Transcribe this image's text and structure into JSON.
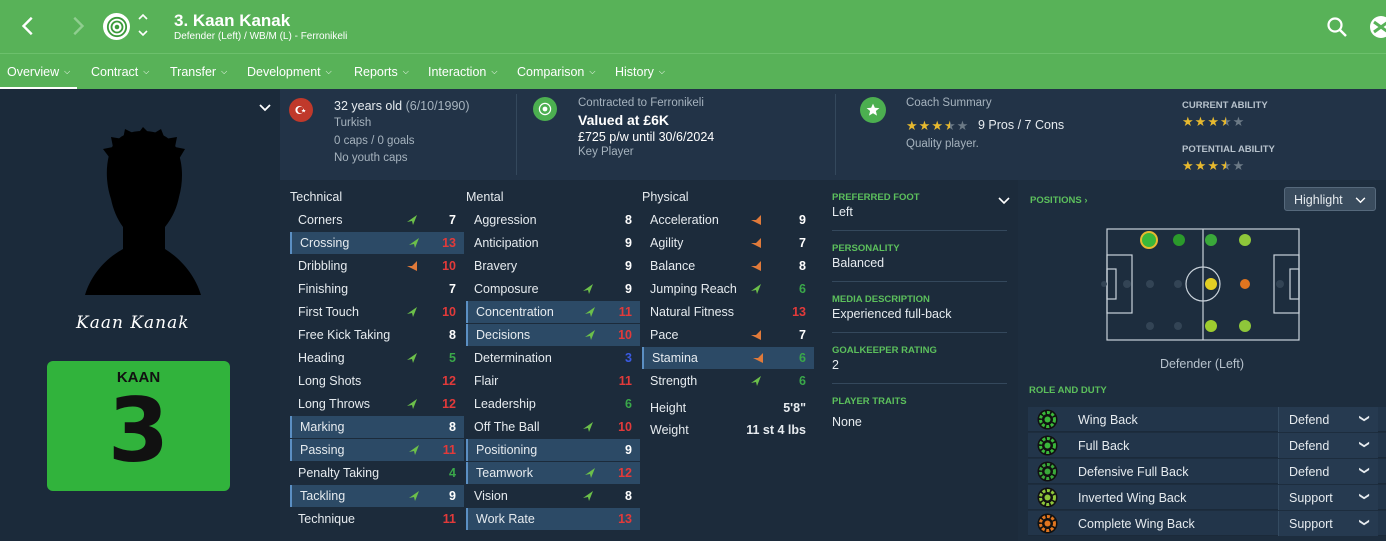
{
  "header": {
    "title": "3. Kaan Kanak",
    "subtitle": "Defender (Left) / WB/M (L) - Ferronikeli"
  },
  "tabs": [
    {
      "label": "Overview"
    },
    {
      "label": "Contract"
    },
    {
      "label": "Transfer"
    },
    {
      "label": "Development"
    },
    {
      "label": "Reports"
    },
    {
      "label": "Interaction"
    },
    {
      "label": "Comparison"
    },
    {
      "label": "History"
    }
  ],
  "player": {
    "signature": "Kaan Kanak",
    "shirt_name": "KAAN",
    "shirt_number": "3",
    "age": "32 years old",
    "dob": "(6/10/1990)",
    "nationality": "Turkish",
    "caps": "0 caps / 0 goals",
    "youth_caps": "No youth caps"
  },
  "contract": {
    "label": "Contracted to Ferronikeli",
    "value": "Valued at £6K",
    "wage": "£725 p/w until 30/6/2024",
    "status": "Key Player"
  },
  "coach": {
    "label": "Coach Summary",
    "stars": 3.5,
    "pros_cons": "9 Pros / 7 Cons",
    "summary": "Quality player."
  },
  "ability": {
    "current_label": "CURRENT ABILITY",
    "current_stars": 3.5,
    "potential_label": "POTENTIAL ABILITY",
    "potential_stars": 3.5
  },
  "attributes": {
    "technical_label": "Technical",
    "mental_label": "Mental",
    "physical_label": "Physical",
    "technical": [
      {
        "name": "Corners",
        "value": "7",
        "arrow": "up",
        "hl": false,
        "color": "#ffffff"
      },
      {
        "name": "Crossing",
        "value": "13",
        "arrow": "up",
        "hl": true,
        "color": "#e23a3a"
      },
      {
        "name": "Dribbling",
        "value": "10",
        "arrow": "down",
        "hl": false,
        "color": "#e23a3a"
      },
      {
        "name": "Finishing",
        "value": "7",
        "arrow": "",
        "hl": false,
        "color": "#ffffff"
      },
      {
        "name": "First Touch",
        "value": "10",
        "arrow": "up",
        "hl": false,
        "color": "#e23a3a"
      },
      {
        "name": "Free Kick Taking",
        "value": "8",
        "arrow": "",
        "hl": false,
        "color": "#ffffff"
      },
      {
        "name": "Heading",
        "value": "5",
        "arrow": "up",
        "hl": false,
        "color": "#3aa84a"
      },
      {
        "name": "Long Shots",
        "value": "12",
        "arrow": "",
        "hl": false,
        "color": "#e23a3a"
      },
      {
        "name": "Long Throws",
        "value": "12",
        "arrow": "up",
        "hl": false,
        "color": "#e23a3a"
      },
      {
        "name": "Marking",
        "value": "8",
        "arrow": "",
        "hl": true,
        "color": "#ffffff"
      },
      {
        "name": "Passing",
        "value": "11",
        "arrow": "up",
        "hl": true,
        "color": "#e23a3a"
      },
      {
        "name": "Penalty Taking",
        "value": "4",
        "arrow": "",
        "hl": false,
        "color": "#3aa84a"
      },
      {
        "name": "Tackling",
        "value": "9",
        "arrow": "up",
        "hl": true,
        "color": "#ffffff"
      },
      {
        "name": "Technique",
        "value": "11",
        "arrow": "",
        "hl": false,
        "color": "#e23a3a"
      }
    ],
    "mental": [
      {
        "name": "Aggression",
        "value": "8",
        "arrow": "",
        "hl": false,
        "color": "#ffffff"
      },
      {
        "name": "Anticipation",
        "value": "9",
        "arrow": "",
        "hl": false,
        "color": "#ffffff"
      },
      {
        "name": "Bravery",
        "value": "9",
        "arrow": "",
        "hl": false,
        "color": "#ffffff"
      },
      {
        "name": "Composure",
        "value": "9",
        "arrow": "up",
        "hl": false,
        "color": "#ffffff"
      },
      {
        "name": "Concentration",
        "value": "11",
        "arrow": "up",
        "hl": true,
        "color": "#e23a3a"
      },
      {
        "name": "Decisions",
        "value": "10",
        "arrow": "up",
        "hl": true,
        "color": "#e23a3a"
      },
      {
        "name": "Determination",
        "value": "3",
        "arrow": "",
        "hl": false,
        "color": "#3a5ae2"
      },
      {
        "name": "Flair",
        "value": "11",
        "arrow": "",
        "hl": false,
        "color": "#e23a3a"
      },
      {
        "name": "Leadership",
        "value": "6",
        "arrow": "",
        "hl": false,
        "color": "#3aa84a"
      },
      {
        "name": "Off The Ball",
        "value": "10",
        "arrow": "up",
        "hl": false,
        "color": "#e23a3a"
      },
      {
        "name": "Positioning",
        "value": "9",
        "arrow": "",
        "hl": true,
        "color": "#ffffff"
      },
      {
        "name": "Teamwork",
        "value": "12",
        "arrow": "up",
        "hl": true,
        "color": "#e23a3a"
      },
      {
        "name": "Vision",
        "value": "8",
        "arrow": "up",
        "hl": false,
        "color": "#ffffff"
      },
      {
        "name": "Work Rate",
        "value": "13",
        "arrow": "",
        "hl": true,
        "color": "#e23a3a"
      }
    ],
    "physical": [
      {
        "name": "Acceleration",
        "value": "9",
        "arrow": "down",
        "hl": false,
        "color": "#ffffff"
      },
      {
        "name": "Agility",
        "value": "7",
        "arrow": "down",
        "hl": false,
        "color": "#ffffff"
      },
      {
        "name": "Balance",
        "value": "8",
        "arrow": "down",
        "hl": false,
        "color": "#ffffff"
      },
      {
        "name": "Jumping Reach",
        "value": "6",
        "arrow": "up",
        "hl": false,
        "color": "#3aa84a"
      },
      {
        "name": "Natural Fitness",
        "value": "13",
        "arrow": "",
        "hl": false,
        "color": "#e23a3a"
      },
      {
        "name": "Pace",
        "value": "7",
        "arrow": "down",
        "hl": false,
        "color": "#ffffff"
      },
      {
        "name": "Stamina",
        "value": "6",
        "arrow": "down",
        "hl": true,
        "color": "#3aa84a"
      },
      {
        "name": "Strength",
        "value": "6",
        "arrow": "up",
        "hl": false,
        "color": "#3aa84a"
      }
    ],
    "height_label": "Height",
    "height": "5'8\"",
    "weight_label": "Weight",
    "weight": "11 st 4 lbs"
  },
  "props": {
    "foot_label": "PREFERRED FOOT",
    "foot": "Left",
    "personality_label": "PERSONALITY",
    "personality": "Balanced",
    "media_label": "MEDIA DESCRIPTION",
    "media": "Experienced full-back",
    "gk_label": "GOALKEEPER RATING",
    "gk": "2",
    "traits_label": "PLAYER TRAITS",
    "traits": "None"
  },
  "positions": {
    "label": "POSITIONS",
    "highlight_label": "Highlight",
    "caption": "Defender (Left)"
  },
  "roles": {
    "label": "ROLE AND DUTY",
    "items": [
      {
        "role": "Wing Back",
        "duty": "Defend"
      },
      {
        "role": "Full Back",
        "duty": "Defend"
      },
      {
        "role": "Defensive Full Back",
        "duty": "Defend"
      },
      {
        "role": "Inverted Wing Back",
        "duty": "Support"
      },
      {
        "role": "Complete Wing Back",
        "duty": "Support"
      }
    ]
  },
  "colors": {
    "brand_green": "#58b258",
    "arrow_up": "#6cc04a",
    "arrow_down": "#e07a3a"
  }
}
